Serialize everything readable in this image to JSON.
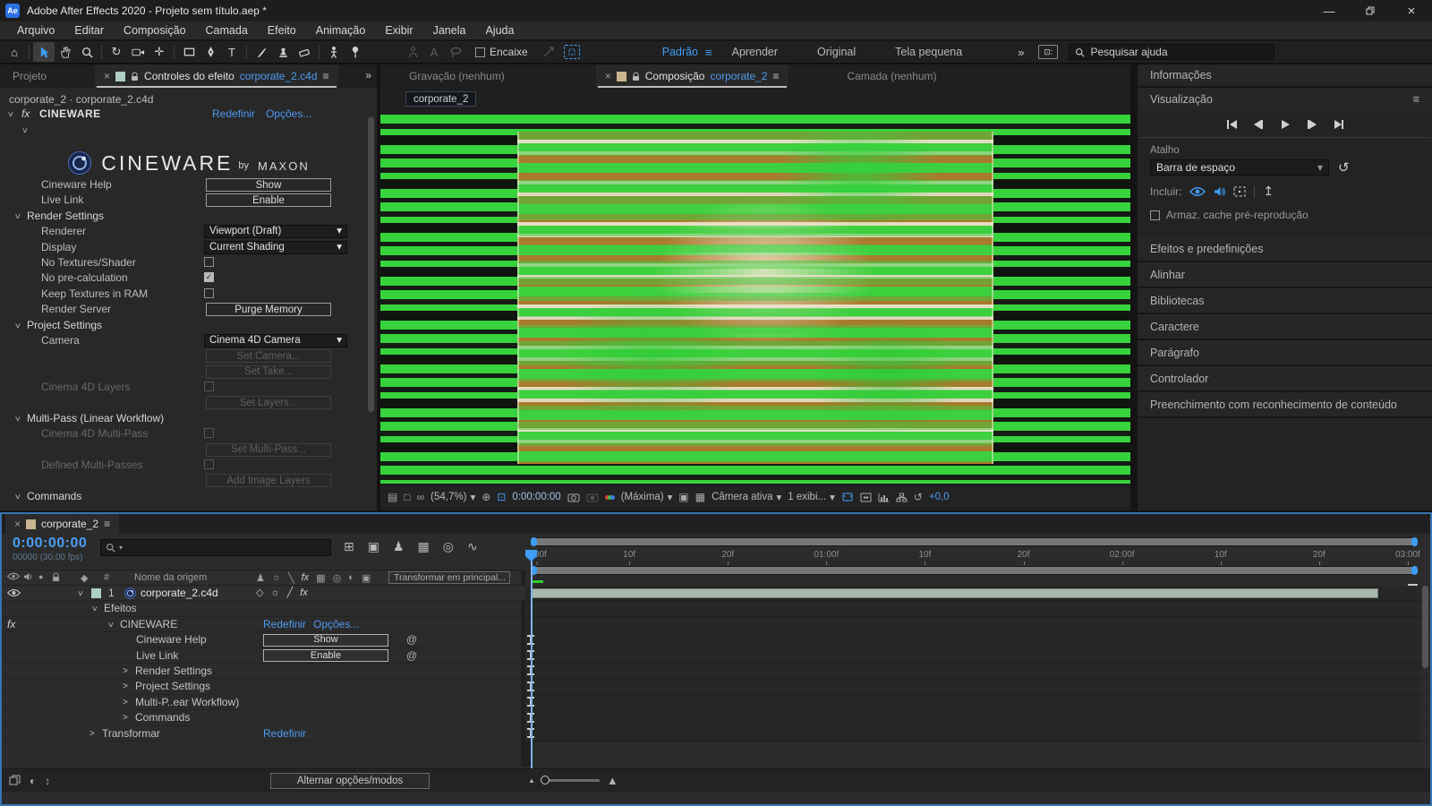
{
  "icons": {
    "hamburger": "≡",
    "chevrons": "»",
    "close": "×",
    "dropdown": "▾",
    "home": "⌂",
    "rotate": "↻",
    "reset": "↺",
    "type": "T",
    "char3d": "A",
    "sun": "☼",
    "quality": "╲",
    "frameblend": "▦",
    "motionblur": "◎",
    "adjustment": "◐",
    "cube": "▣",
    "diamond": "◇",
    "solo": "●",
    "graph": "∿",
    "flowchart": "⊞",
    "shy": "♟",
    "expression": "@",
    "fx": "fx",
    "tag": "◆",
    "hash": "#",
    "export": "↥",
    "vr": "∞",
    "target": "⊕",
    "roi": "⊡",
    "checker": "▦",
    "rectinrect": "▣",
    "monitor": "□",
    "stack": "▤",
    "check": "✓",
    "blend": "◐",
    "inout": "↕",
    "mountain": "▲",
    "minimize": "—",
    "panplus": "✛",
    "dot": "·"
  },
  "labels": {
    "reset": "Redefinir",
    "options": "Opções...",
    "show": "Show",
    "enable": "Enable"
  },
  "titlebar": {
    "app": "Ae",
    "title": "Adobe After Effects 2020 - Projeto sem título.aep *"
  },
  "menus": [
    "Arquivo",
    "Editar",
    "Composição",
    "Camada",
    "Efeito",
    "Animação",
    "Exibir",
    "Janela",
    "Ajuda"
  ],
  "toolbar": {
    "snap": "Encaixe",
    "workspaces": [
      "Padrão",
      "Aprender",
      "Original",
      "Tela pequena"
    ],
    "active_workspace": "Padrão",
    "search_placeholder": "Pesquisar ajuda"
  },
  "tools": [
    {
      "name": "home-tool",
      "glyph": "⌂"
    },
    {
      "name": "sep"
    },
    {
      "name": "selection-tool",
      "svg": "cursor",
      "selected": true
    },
    {
      "name": "hand-tool",
      "svg": "hand"
    },
    {
      "name": "zoom-tool",
      "svg": "zoom"
    },
    {
      "name": "sep"
    },
    {
      "name": "rotate-tool",
      "glyph": "↻"
    },
    {
      "name": "camera-tool",
      "svg": "camera"
    },
    {
      "name": "pan-behind-tool",
      "glyph": "✛"
    },
    {
      "name": "sep"
    },
    {
      "name": "shape-tool",
      "svg": "rect"
    },
    {
      "name": "pen-tool",
      "svg": "pen"
    },
    {
      "name": "type-tool",
      "glyph": "T"
    },
    {
      "name": "sep"
    },
    {
      "name": "brush-tool",
      "svg": "brush"
    },
    {
      "name": "stamp-tool",
      "svg": "stamp"
    },
    {
      "name": "eraser-tool",
      "svg": "eraser"
    },
    {
      "name": "sep"
    },
    {
      "name": "roto-brush-tool",
      "svg": "roto"
    },
    {
      "name": "puppet-pin-tool",
      "svg": "pin"
    },
    {
      "name": "gap"
    },
    {
      "name": "figure-tool",
      "svg": "person",
      "disabled": true
    },
    {
      "name": "char-3d-tool",
      "glyph": "A",
      "disabled": true
    },
    {
      "name": "lasso-tool",
      "svg": "lasso",
      "disabled": true
    }
  ],
  "effect_panel": {
    "tab_project": "Projeto",
    "tab_controls_prefix": "Controles do efeito",
    "tab_controls_target": "corporate_2.c4d",
    "breadcrumb": "corporate_2 · corporate_2.c4d",
    "effect_name": "CINEWARE",
    "logo": {
      "brand": "CINEWARE",
      "by": "by",
      "maker": "MAXON"
    },
    "rows": [
      {
        "type": "button",
        "label": "Cineware Help",
        "value": "Show"
      },
      {
        "type": "button",
        "label": "Live Link",
        "value": "Enable"
      },
      {
        "type": "group",
        "label": "Render Settings"
      },
      {
        "type": "dropdown",
        "label": "Renderer",
        "value": "Viewport (Draft)"
      },
      {
        "type": "dropdown",
        "label": "Display",
        "value": "Current Shading"
      },
      {
        "type": "checkbox",
        "label": "No Textures/Shader",
        "checked": false
      },
      {
        "type": "checkbox",
        "label": "No pre-calculation",
        "checked": true
      },
      {
        "type": "checkbox",
        "label": "Keep Textures in RAM",
        "checked": false
      },
      {
        "type": "button",
        "label": "Render Server",
        "value": "Purge Memory"
      },
      {
        "type": "group",
        "label": "Project Settings"
      },
      {
        "type": "dropdown",
        "label": "Camera",
        "value": "Cinema 4D Camera"
      },
      {
        "type": "button",
        "label": "",
        "value": "Set Camera...",
        "disabled": true
      },
      {
        "type": "button",
        "label": "",
        "value": "Set Take...",
        "disabled": true
      },
      {
        "type": "checkbox",
        "label": "Cinema 4D Layers",
        "checked": false,
        "disabled": true
      },
      {
        "type": "button",
        "label": "",
        "value": "Set Layers...",
        "disabled": true
      },
      {
        "type": "group",
        "label": "Multi-Pass (Linear Workflow)"
      },
      {
        "type": "checkbox",
        "label": "Cinema 4D Multi-Pass",
        "checked": false,
        "disabled": true
      },
      {
        "type": "button",
        "label": "",
        "value": "Set Multi-Pass...",
        "disabled": true
      },
      {
        "type": "checkbox",
        "label": "Defined Multi-Passes",
        "checked": false,
        "disabled": true
      },
      {
        "type": "button",
        "label": "",
        "value": "Add Image Layers",
        "disabled": true
      },
      {
        "type": "group",
        "label": "Commands"
      }
    ]
  },
  "viewer": {
    "tab_footage": "Gravação  (nenhum)",
    "tab_comp_prefix": "Composição",
    "tab_comp_target": "corporate_2",
    "tab_layer": "Camada  (nenhum)",
    "chip": "corporate_2",
    "zoom": "(54,7%)",
    "timecode": "0:00:00:00",
    "resolution": "(Máxima)",
    "camera": "Câmera ativa",
    "views": "1 exibi...",
    "exposure": "+0,0"
  },
  "right_panel": {
    "info": "Informações",
    "preview": "Visualização",
    "shortcut_label": "Atalho",
    "shortcut_value": "Barra de espaço",
    "include_label": "Incluir:",
    "cache_checkbox": "Armaz. cache pré-reprodução",
    "collapsed": [
      "Efeitos e predefinições",
      "Alinhar",
      "Bibliotecas",
      "Caractere",
      "Parágrafo",
      "Controlador",
      "Preenchimento com reconhecimento de conteúdo"
    ]
  },
  "timeline": {
    "tab": "corporate_2",
    "timecode": "0:00:00:00",
    "frames_info": "00000 (30.00 fps)",
    "source_name_col": "Nome da origem",
    "hash_col": "#",
    "parent_col": "Transformar em principal...",
    "rows": [
      {
        "kind": "layer",
        "num": "1",
        "name": "corporate_2.c4d"
      },
      {
        "kind": "group",
        "label": "Efeitos",
        "indent": 1,
        "open": true
      },
      {
        "kind": "effect",
        "label": "CINEWARE",
        "open": true
      },
      {
        "kind": "prop",
        "label": "Cineware Help",
        "button": "Show",
        "ibeam": true
      },
      {
        "kind": "prop",
        "label": "Live Link",
        "button": "Enable",
        "ibeam": true
      },
      {
        "kind": "group",
        "label": "Render Settings",
        "indent": 3,
        "open": false,
        "ibeam": true
      },
      {
        "kind": "group",
        "label": "Project Settings",
        "indent": 3,
        "open": false,
        "ibeam": true
      },
      {
        "kind": "group",
        "label": "Multi-P..ear Workflow)",
        "indent": 3,
        "open": false,
        "ibeam": true
      },
      {
        "kind": "group",
        "label": "Commands",
        "indent": 3,
        "open": false,
        "ibeam": true
      },
      {
        "kind": "transform",
        "label": "Transformar",
        "link": "Redefinir",
        "ibeam": true
      }
    ],
    "ruler_ticks": [
      "0:00f",
      "10f",
      "20f",
      "01:00f",
      "10f",
      "20f",
      "02:00f",
      "10f",
      "20f",
      "03:00f"
    ],
    "footer_toggle": "Alternar opções/modos"
  },
  "colors": {
    "accent": "#3e9df5",
    "link": "#4e9af0",
    "green_stripe": "#38d03c",
    "timecode_blue": "#4b9ef5",
    "comp_swatch": "#c8b48e",
    "fx_swatch": "#aecfc2"
  }
}
